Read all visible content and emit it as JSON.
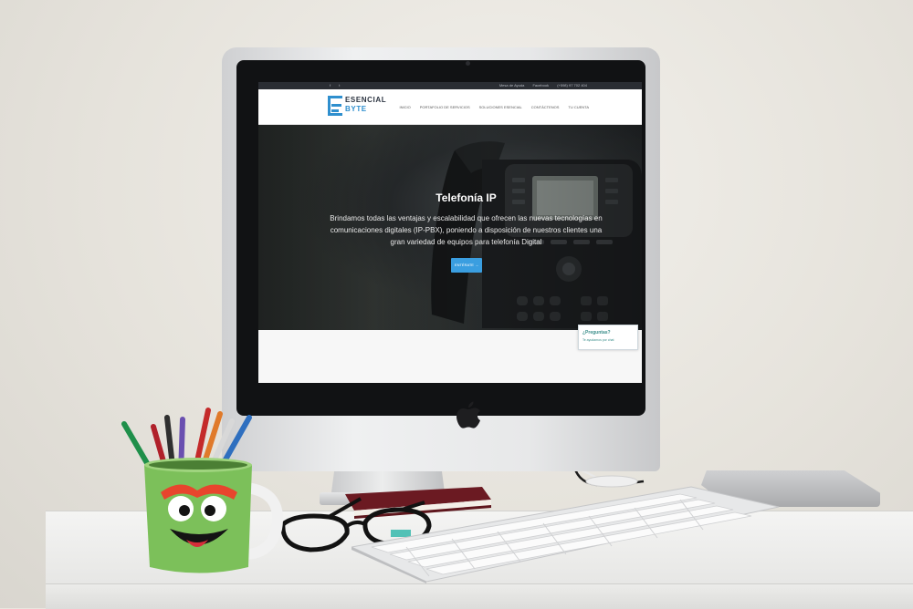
{
  "website": {
    "topbar": {
      "social": "f  t",
      "contact": [
        "Mesa de Ayuda",
        "Facebook",
        "(+598) 97 702 404"
      ]
    },
    "logo": {
      "line1": "ESENCIAL",
      "line2": "BYTE"
    },
    "menu": [
      "INICIO",
      "PORTAFOLIO DE SERVICIOS",
      "SOLUCIONES ESENCIAL",
      "CONTÁCTENOS",
      "TU CUENTA"
    ],
    "hero": {
      "title": "Telefonía IP",
      "text": "Brindamos todas las ventajas y escalabilidad que ofrecen las nuevas tecnologías en comunicaciones digitales (IP-PBX), poniendo a disposición de nuestros clientes una gran variedad de equipos para telefonía Digital",
      "button": "ENTÉRATE →"
    },
    "chat": {
      "question": "¿Preguntas?",
      "subtitle": "Te ayudamos por chat"
    }
  },
  "colors": {
    "brand_blue": "#2f8fce",
    "button_blue": "#3a9ee0",
    "mug_green": "#7cc05a",
    "wall": "#ebe8e2"
  }
}
